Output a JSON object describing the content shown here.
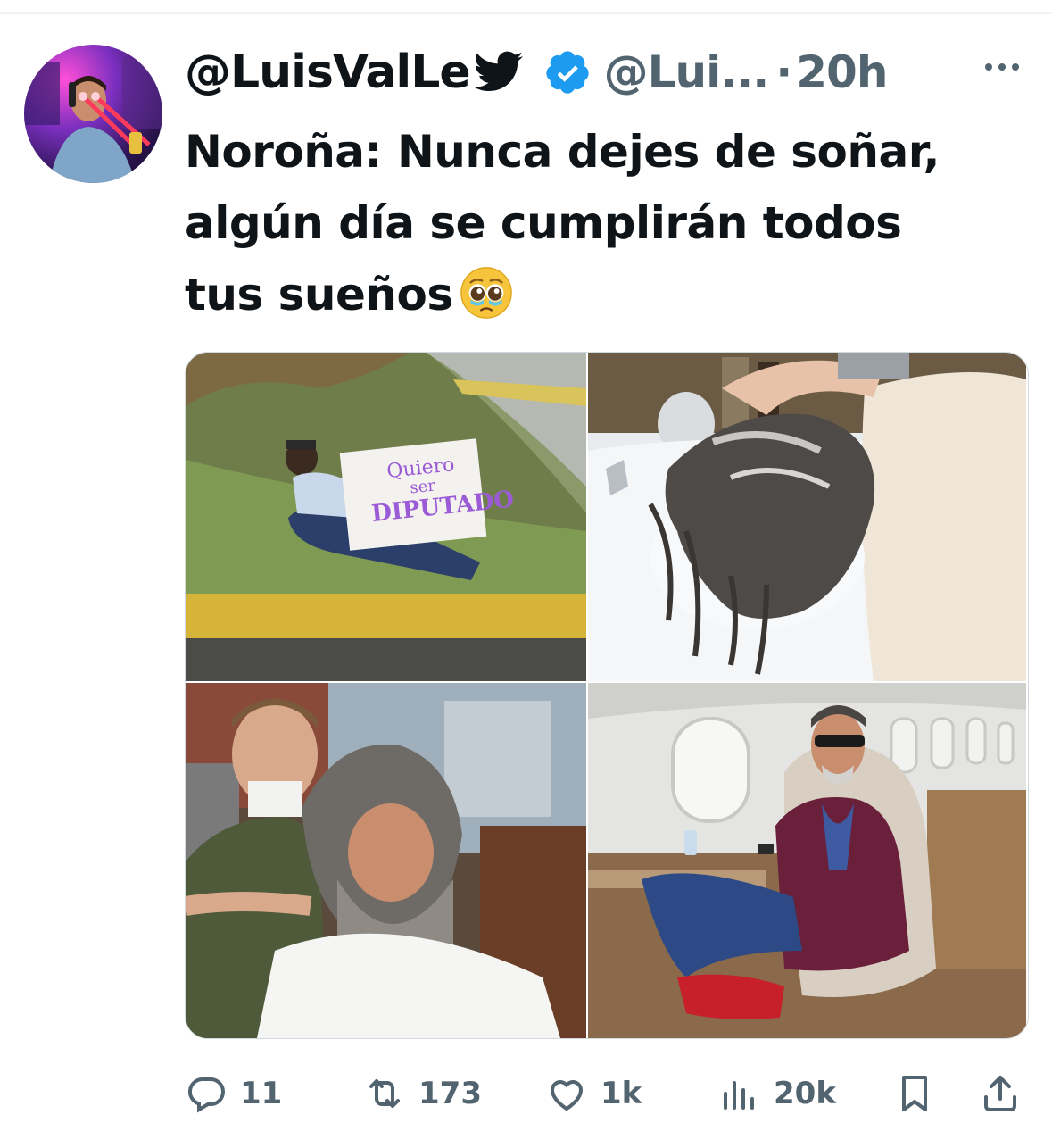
{
  "tweet": {
    "display_name": "@LuisValLe",
    "handle": "@Lui...",
    "separator": "·",
    "time": "20h",
    "text_line1": "Noroña: Nunca dejes de soñar,",
    "text_line2": "algún día se cumplirán todos",
    "text_line3": "tus sueños",
    "emoji": "pleading-face-emoji"
  },
  "media": {
    "photo1_sign_line1": "Quiero",
    "photo1_sign_line2": "ser",
    "photo1_sign_line3": "DIPUTADO"
  },
  "actions": {
    "replies": "11",
    "retweets": "173",
    "likes": "1k",
    "views": "20k"
  },
  "icons": {
    "bird": "twitter-bird-icon",
    "verified": "verified-badge-icon",
    "more": "more-options-icon",
    "reply": "reply-icon",
    "retweet": "retweet-icon",
    "like": "heart-icon",
    "views": "views-chart-icon",
    "bookmark": "bookmark-icon",
    "share": "share-icon"
  },
  "colors": {
    "text": "#0f1419",
    "secondary": "#536471",
    "verified": "#1d9bf0"
  }
}
